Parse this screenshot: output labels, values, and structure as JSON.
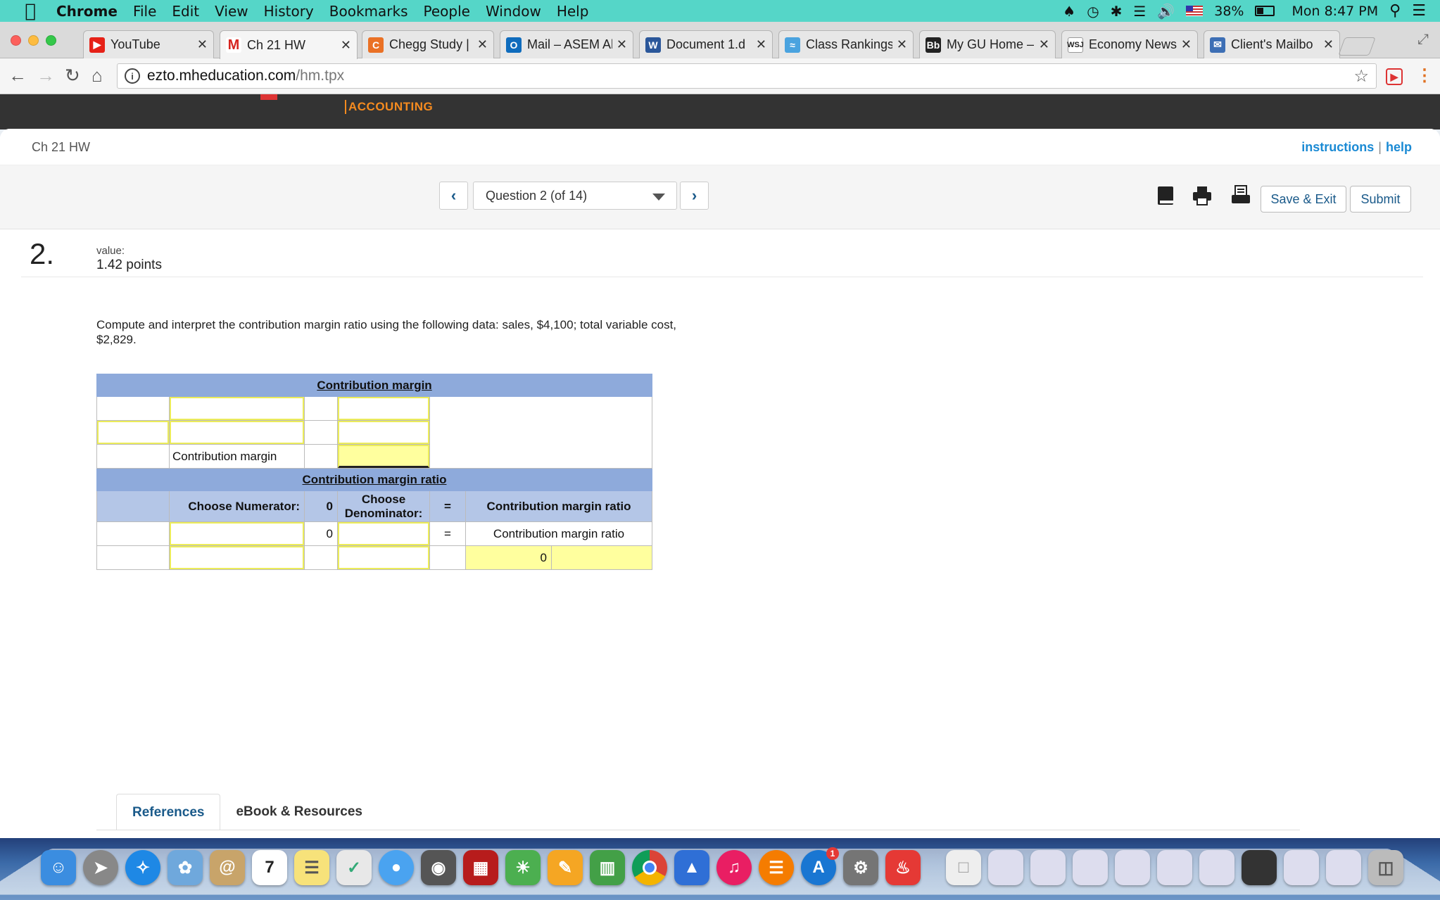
{
  "menubar": {
    "app": "Chrome",
    "items": [
      "File",
      "Edit",
      "View",
      "History",
      "Bookmarks",
      "People",
      "Window",
      "Help"
    ],
    "battery": "38%",
    "clock": "Mon 8:47 PM"
  },
  "tabs": [
    {
      "title": "YouTube",
      "favicon": "youtube-icon",
      "color": "#e62117"
    },
    {
      "title": "Ch 21 HW",
      "favicon": "mcgraw-hill-icon",
      "color": "#d6241f"
    },
    {
      "title": "Chegg Study |",
      "favicon": "chegg-icon",
      "color": "#ea7125"
    },
    {
      "title": "Mail – ASEM Al",
      "favicon": "outlook-icon",
      "color": "#0f6cbd"
    },
    {
      "title": "Document 1.d",
      "favicon": "word-icon",
      "color": "#2b579a"
    },
    {
      "title": "Class Rankings",
      "favicon": "chart-icon",
      "color": "#4aa3df"
    },
    {
      "title": "My GU Home –",
      "favicon": "blackboard-icon",
      "color": "#222222"
    },
    {
      "title": "Economy News",
      "favicon": "wsj-icon",
      "color": "#ffffff"
    },
    {
      "title": "Client's Mailbo",
      "favicon": "mailbox-icon",
      "color": "#3d6fb5"
    }
  ],
  "address": {
    "host": "ezto.mheducation.com",
    "path": "/hm.tpx"
  },
  "hero": {
    "logo": "ACCOUNTING"
  },
  "assignment": {
    "title": "Ch 21 HW",
    "instructions": "instructions",
    "separator": "|",
    "help": "help"
  },
  "toolbar": {
    "prev": "‹",
    "question_select": "Question 2 (of 14)",
    "next": "›",
    "save_exit": "Save & Exit",
    "submit": "Submit"
  },
  "question": {
    "number": "2.",
    "value_label": "value:",
    "points": "1.42 points",
    "prompt": "Compute and interpret the contribution margin ratio using the following data: sales, $4,100; total variable cost, $2,829."
  },
  "worksheet": {
    "section1_header": "Contribution margin",
    "cm_row_label": "Contribution margin",
    "section2_header": "Contribution margin ratio",
    "col_numerator": "Choose Numerator:",
    "col_zero": "0",
    "col_denominator": "Choose Denominator:",
    "col_equals": "=",
    "col_result": "Contribution margin ratio",
    "row1_zero": "0",
    "row1_equals": "=",
    "row1_result": "Contribution margin ratio",
    "row2_result": "0"
  },
  "bottom_tabs": {
    "references": "References",
    "ebook": "eBook & Resources"
  },
  "dock": {
    "calendar_day": "7",
    "appstore_badge": "1"
  }
}
